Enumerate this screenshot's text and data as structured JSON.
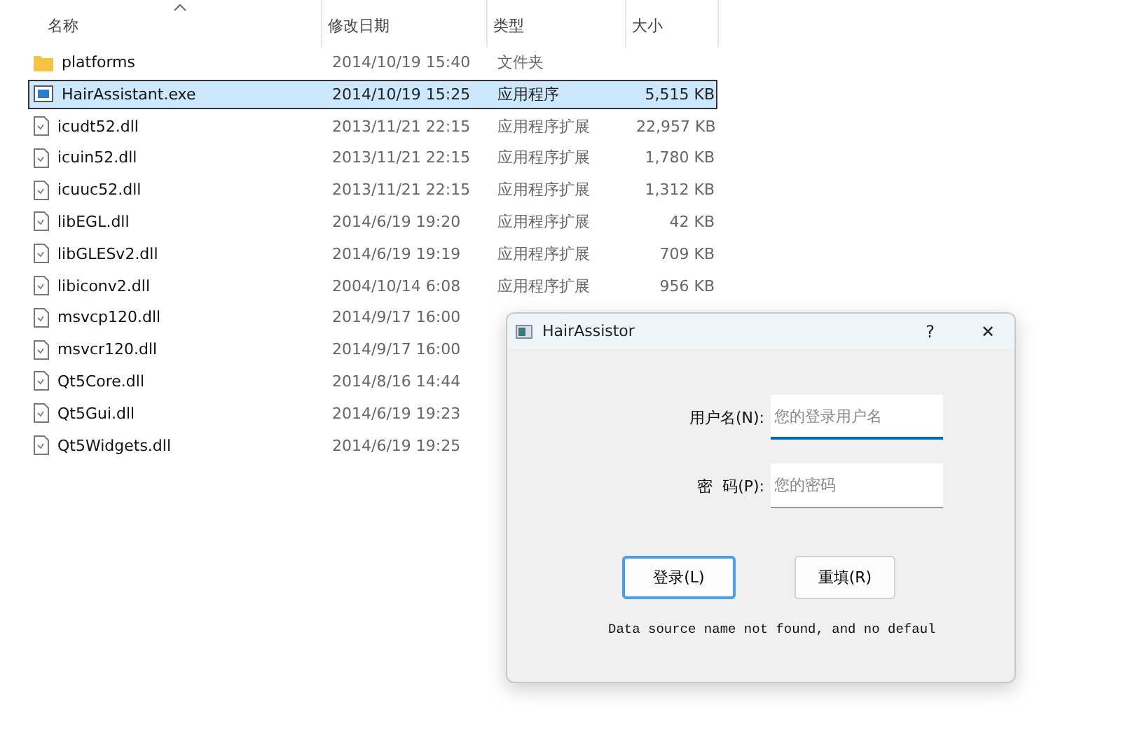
{
  "columns": [
    {
      "label": "名称",
      "sorted": true
    },
    {
      "label": "修改日期"
    },
    {
      "label": "类型"
    },
    {
      "label": "大小"
    }
  ],
  "files": [
    {
      "kind": "folder",
      "name": "platforms",
      "date": "2014/10/19 15:40",
      "type": "文件夹",
      "selected": false
    },
    {
      "kind": "app",
      "name": "HairAssistant.exe",
      "date": "2014/10/19 15:25",
      "type": "应用程序",
      "size": "5,515 KB",
      "selected": true
    },
    {
      "kind": "dll",
      "name": "icudt52.dll",
      "date": "2013/11/21 22:15",
      "type": "应用程序扩展",
      "size": "22,957 KB",
      "selected": false
    },
    {
      "kind": "dll",
      "name": "icuin52.dll",
      "date": "2013/11/21 22:15",
      "type": "应用程序扩展",
      "size": "1,780 KB",
      "selected": false
    },
    {
      "kind": "dll",
      "name": "icuuc52.dll",
      "date": "2013/11/21 22:15",
      "type": "应用程序扩展",
      "size": "1,312 KB",
      "selected": false
    },
    {
      "kind": "dll",
      "name": "libEGL.dll",
      "date": "2014/6/19 19:20",
      "type": "应用程序扩展",
      "size": "42 KB",
      "selected": false
    },
    {
      "kind": "dll",
      "name": "libGLESv2.dll",
      "date": "2014/6/19 19:19",
      "type": "应用程序扩展",
      "size": "709 KB",
      "selected": false
    },
    {
      "kind": "dll",
      "name": "libiconv2.dll",
      "date": "2004/10/14 6:08",
      "type": "应用程序扩展",
      "size": "956 KB",
      "selected": false
    },
    {
      "kind": "dll",
      "name": "msvcp120.dll",
      "date": "2014/9/17 16:00",
      "selected": false
    },
    {
      "kind": "dll",
      "name": "msvcr120.dll",
      "date": "2014/9/17 16:00",
      "selected": false
    },
    {
      "kind": "dll",
      "name": "Qt5Core.dll",
      "date": "2014/8/16 14:44",
      "selected": false
    },
    {
      "kind": "dll",
      "name": "Qt5Gui.dll",
      "date": "2014/6/19 19:23",
      "selected": false
    },
    {
      "kind": "dll",
      "name": "Qt5Widgets.dll",
      "date": "2014/6/19 19:25",
      "selected": false
    }
  ],
  "dialog": {
    "title": "HairAssistor",
    "help": "?",
    "close": "✕",
    "fields": [
      {
        "label": "用户名(N):",
        "placeholder": "您的登录用户名",
        "focused": true
      },
      {
        "label": "密  码(P):",
        "placeholder": "您的密码",
        "focused": false
      }
    ],
    "buttons": [
      {
        "label": "登录(L)",
        "default": true
      },
      {
        "label": "重填(R)",
        "default": false
      }
    ],
    "status": "Data source name not found, and no defaul"
  }
}
